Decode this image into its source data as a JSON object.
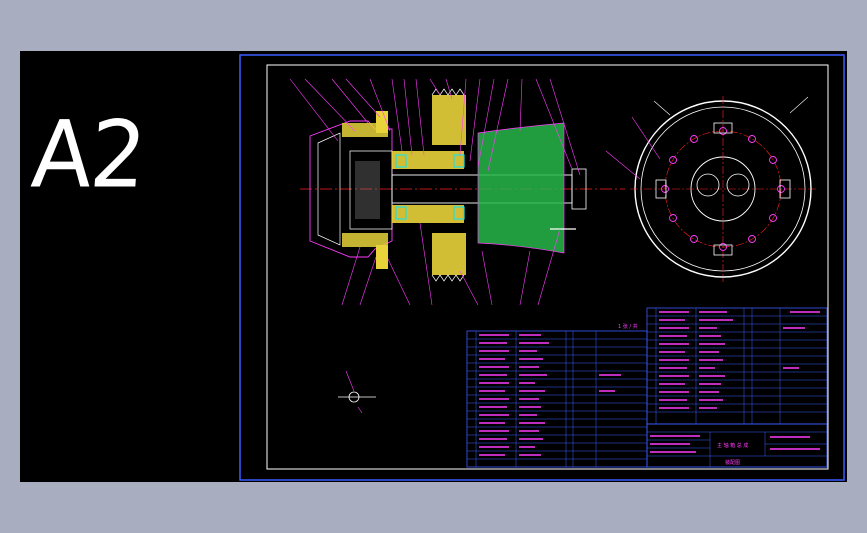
{
  "sheet_label": "A2",
  "colors": {
    "window_bg": "#a9adc0",
    "canvas_bg": "#000000",
    "border_blue": "#3b5cff",
    "frame_white": "#ffffff",
    "outline_magenta": "#ff3cff",
    "center_red": "#ff2020",
    "hatch_yellow": "#e8d33a",
    "hatch_green": "#27b84a",
    "bearing_cyan": "#22e0e0"
  },
  "title_block": {
    "drawing_title": "主 轴 箱 总 成",
    "subtitle": "装配图",
    "sheet_note": "1 张 / 共"
  }
}
